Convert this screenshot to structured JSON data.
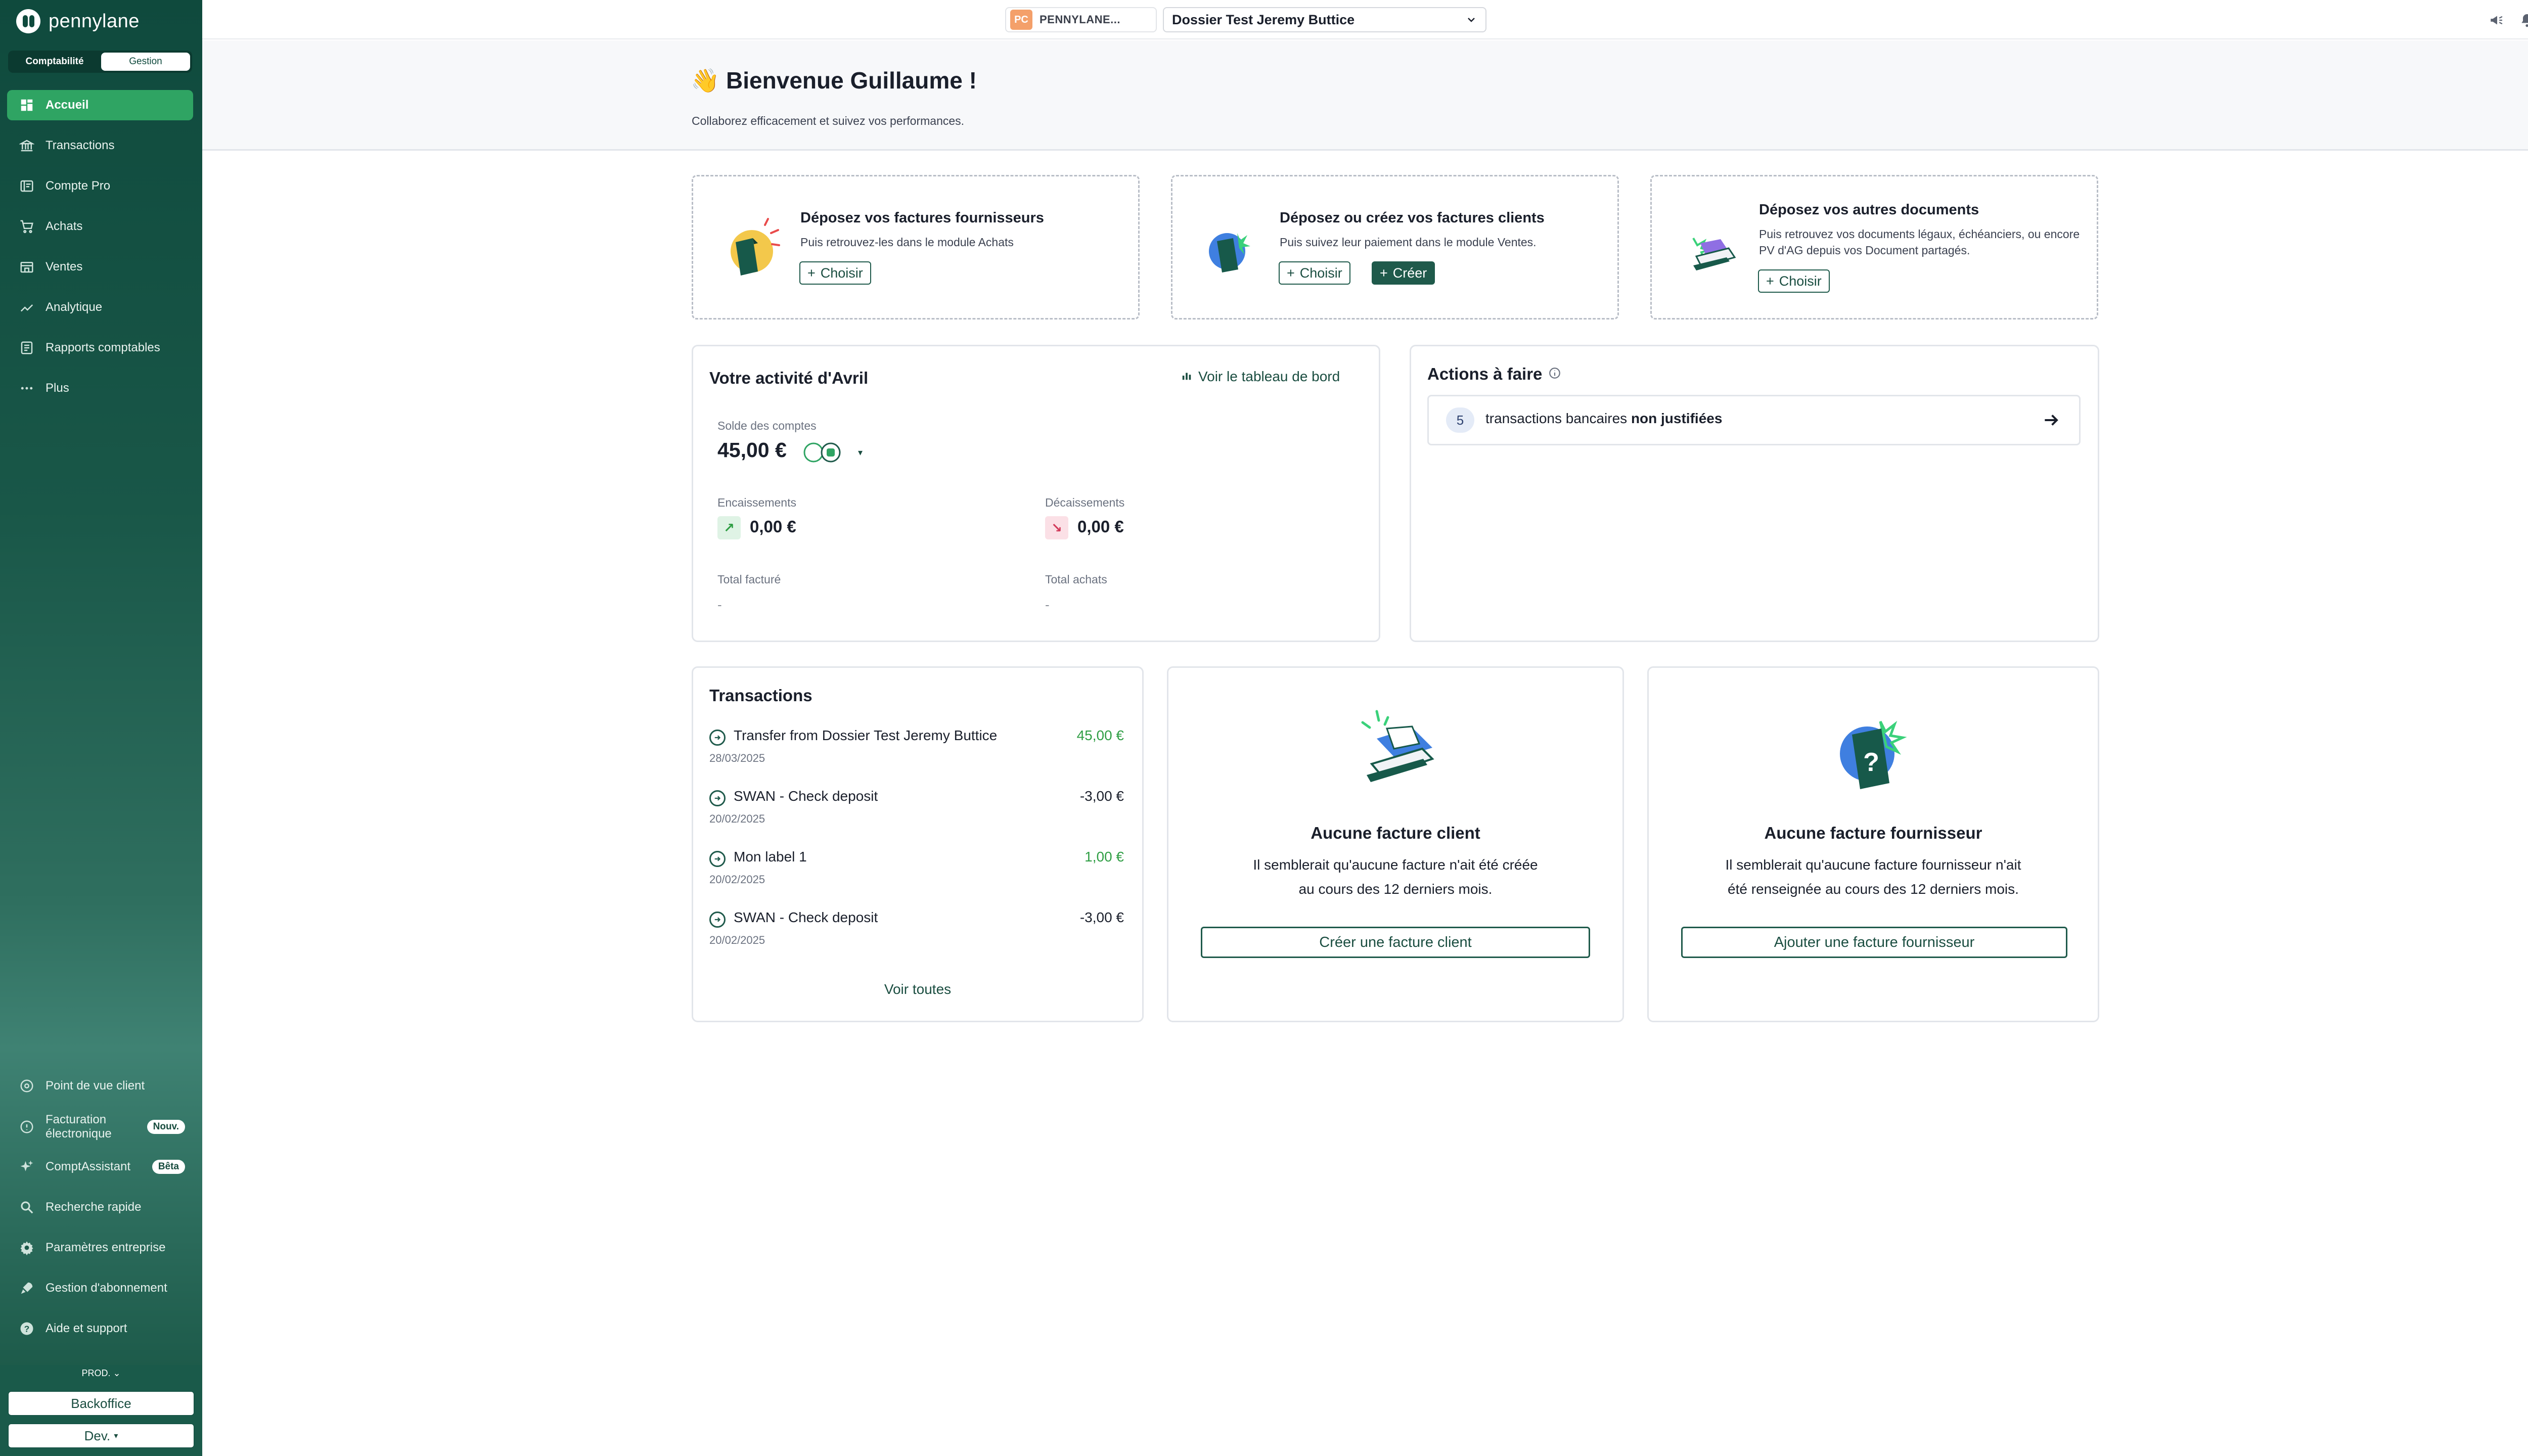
{
  "sidebar": {
    "brand": "pennylane",
    "segment": {
      "left": "Comptabilité",
      "right": "Gestion"
    },
    "items": [
      {
        "label": "Accueil",
        "icon": "dashboard-icon"
      },
      {
        "label": "Transactions",
        "icon": "bank-icon"
      },
      {
        "label": "Compte Pro",
        "icon": "card-icon"
      },
      {
        "label": "Achats",
        "icon": "cart-icon"
      },
      {
        "label": "Ventes",
        "icon": "store-icon"
      },
      {
        "label": "Analytique",
        "icon": "chart-line-icon"
      },
      {
        "label": "Rapports comptables",
        "icon": "report-icon"
      },
      {
        "label": "Plus",
        "icon": "more-icon"
      }
    ],
    "bottom_items": [
      {
        "label": "Point de vue client",
        "icon": "eye-icon"
      },
      {
        "label1": "Facturation",
        "label2": "électronique",
        "badge": "Nouv.",
        "icon": "info-icon"
      },
      {
        "label": "ComptAssistant",
        "badge": "Bêta",
        "icon": "sparkle-icon"
      },
      {
        "label": "Recherche rapide",
        "icon": "search-icon"
      },
      {
        "label": "Paramètres entreprise",
        "icon": "gear-icon"
      },
      {
        "label": "Gestion d'abonnement",
        "icon": "rocket-icon"
      },
      {
        "label": "Aide et support",
        "icon": "help-icon"
      }
    ],
    "env": "PROD.",
    "backoffice": "Backoffice",
    "dev": "Dev."
  },
  "topbar": {
    "company_initials": "PC",
    "company_name": "PENNYLANE...",
    "dossier": "Dossier Test Jeremy Buttice"
  },
  "header": {
    "title": "👋 Bienvenue Guillaume !",
    "subtitle": "Collaborez efficacement et suivez vos performances."
  },
  "dropzones": [
    {
      "title": "Déposez vos factures fournisseurs",
      "text": "Puis retrouvez-les dans le module Achats",
      "choose": "Choisir"
    },
    {
      "title": "Déposez ou créez vos factures clients",
      "text": "Puis suivez leur paiement dans le module Ventes.",
      "choose": "Choisir",
      "create": "Créer"
    },
    {
      "title": "Déposez vos autres documents",
      "text": "Puis retrouvez vos documents légaux, échéanciers, ou encore PV d'AG depuis vos Document partagés.",
      "choose": "Choisir"
    }
  ],
  "activity": {
    "title": "Votre activité d'Avril",
    "dashboard_link": "Voir le tableau de bord",
    "balance_label": "Solde des comptes",
    "balance": "45,00 €",
    "in_label": "Encaissements",
    "in_value": "0,00 €",
    "out_label": "Décaissements",
    "out_value": "0,00 €",
    "billed_label": "Total facturé",
    "billed_value": "-",
    "purchases_label": "Total achats",
    "purchases_value": "-"
  },
  "actions": {
    "title": "Actions à faire",
    "count": "5",
    "text": "transactions bancaires",
    "text_bold": "non justifiées"
  },
  "transactions": {
    "title": "Transactions",
    "rows": [
      {
        "name": "Transfer from Dossier Test Jeremy Buttice",
        "date": "28/03/2025",
        "value": "45,00 €",
        "positive": true
      },
      {
        "name": "SWAN - Check deposit",
        "date": "20/02/2025",
        "value": "-3,00 €",
        "positive": false
      },
      {
        "name": "Mon label 1",
        "date": "20/02/2025",
        "value": "1,00 €",
        "positive": true
      },
      {
        "name": "SWAN - Check deposit",
        "date": "20/02/2025",
        "value": "-3,00 €",
        "positive": false
      }
    ],
    "see_all": "Voir toutes"
  },
  "empty_client": {
    "title": "Aucune facture client",
    "line1": "Il semblerait qu'aucune facture n'ait été créée",
    "line2": "au cours des 12 derniers mois.",
    "button": "Créer une facture client"
  },
  "empty_supplier": {
    "title": "Aucune facture fournisseur",
    "line1": "Il semblerait qu'aucune facture fournisseur n'ait",
    "line2": "été renseignée au cours des 12 derniers mois.",
    "button": "Ajouter une facture fournisseur"
  },
  "colors": {
    "brand_dark": "#0f4a3d",
    "active_green": "#2fa463",
    "positive": "#2f9e44"
  }
}
